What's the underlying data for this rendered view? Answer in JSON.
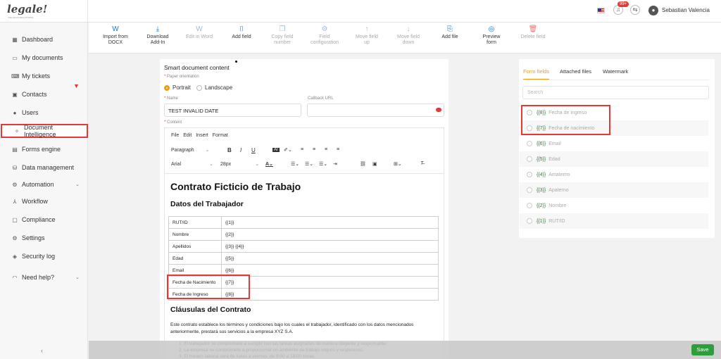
{
  "brand": {
    "logo_text": "legale!",
    "logo_sub": "THE LEGALTECH PORTAL"
  },
  "topbar": {
    "notif_badge": "99+",
    "username": "Sebastian Valencia"
  },
  "sidebar": {
    "items": [
      {
        "label": "Dashboard",
        "icon": "dashboard-icon",
        "glyph": "▦"
      },
      {
        "label": "My documents",
        "icon": "folder-icon",
        "glyph": "▭"
      },
      {
        "label": "My tickets",
        "icon": "ticket-icon",
        "glyph": "⌨"
      },
      {
        "label": "Contacts",
        "icon": "contacts-icon",
        "glyph": "▣"
      },
      {
        "label": "Users",
        "icon": "user-icon",
        "glyph": "●"
      },
      {
        "label": "Document Intelligence",
        "icon": "sparkle-icon",
        "glyph": "✧"
      },
      {
        "label": "Forms engine",
        "icon": "form-icon",
        "glyph": "▤"
      },
      {
        "label": "Data management",
        "icon": "database-icon",
        "glyph": "⛁"
      },
      {
        "label": "Automation",
        "icon": "automation-icon",
        "glyph": "⚙"
      },
      {
        "label": "Workflow",
        "icon": "workflow-icon",
        "glyph": "⅄"
      },
      {
        "label": "Compliance",
        "icon": "compliance-icon",
        "glyph": "▢"
      },
      {
        "label": "Settings",
        "icon": "settings-icon",
        "glyph": "⚙"
      },
      {
        "label": "Security log",
        "icon": "shield-icon",
        "glyph": "◈"
      },
      {
        "label": "Need help?",
        "icon": "headset-icon",
        "glyph": "◠"
      }
    ],
    "collapse_label": "‹"
  },
  "toolbar": {
    "buttons": [
      {
        "label_1": "Import from",
        "label_2": "DOCX",
        "icon": "word-icon",
        "glyph": "W"
      },
      {
        "label_1": "Download",
        "label_2": "Add-In",
        "icon": "download-icon",
        "glyph": "⤓"
      },
      {
        "label_1": "Edit in Word",
        "label_2": "",
        "icon": "word-icon",
        "glyph": "W"
      },
      {
        "label_1": "Add field",
        "label_2": "",
        "icon": "add-field-icon",
        "glyph": "⌷"
      },
      {
        "label_1": "Copy field",
        "label_2": "number",
        "icon": "copy-icon",
        "glyph": "❐"
      },
      {
        "label_1": "Field",
        "label_2": "configuration",
        "icon": "gear-icon",
        "glyph": "⚙"
      },
      {
        "label_1": "Move field",
        "label_2": "up",
        "icon": "arrow-up-icon",
        "glyph": "↑"
      },
      {
        "label_1": "Move field",
        "label_2": "down",
        "icon": "arrow-down-icon",
        "glyph": "↓"
      },
      {
        "label_1": "Add file",
        "label_2": "",
        "icon": "add-file-icon",
        "glyph": "⎘"
      },
      {
        "label_1": "Preview",
        "label_2": "form",
        "icon": "eye-icon",
        "glyph": "◎"
      },
      {
        "label_1": "Delete field",
        "label_2": "",
        "icon": "trash-icon",
        "glyph": "🗑"
      }
    ]
  },
  "form": {
    "title": "Smart document content",
    "orientation_label": "Paper orientation",
    "orientation_options": [
      "Portrait",
      "Landscape"
    ],
    "name_label": "Name",
    "name_value": "TEST INVALID DATE",
    "callback_label": "Callback URL",
    "callback_value": "",
    "content_label": "Content"
  },
  "editor": {
    "menus": "File Edit Insert Format",
    "block_format": "Paragraph",
    "font_family": "Arial",
    "font_size": "28px"
  },
  "document": {
    "h1": "Contrato Ficticio de Trabajo",
    "h2_worker": "Datos del Trabajador",
    "rows": [
      [
        "RUT/ID",
        "{{1}}"
      ],
      [
        "Nombre",
        "{{2}}"
      ],
      [
        "Apellidos",
        "{{3}} {{4}}"
      ],
      [
        "Edad",
        "{{5}}"
      ],
      [
        "Email",
        "{{6}}"
      ],
      [
        "Fecha de Nacimiento",
        "{{7}}"
      ],
      [
        "Fecha de Ingreso",
        "{{8}}"
      ]
    ],
    "h2_clauses": "Cláusulas del Contrato",
    "paragraph": "Este contrato establece los términos y condiciones bajo los cuales el trabajador, identificado con los datos mencionados anteriormente, prestará sus servicios a la empresa XYZ S.A.",
    "clauses": [
      "1. El trabajador se compromete a cumplir con las tareas asignadas de manera diligente y responsable.",
      "2. La empresa se compromete a proporcionar un ambiente de trabajo seguro y respetuoso.",
      "3. El horario laboral será de lunes a viernes, de 9:00 a 18:00 horas."
    ]
  },
  "panel": {
    "tabs": [
      "Form fields",
      "Attached files",
      "Watermark"
    ],
    "search_placeholder": "Search",
    "fields": [
      {
        "code": "{{8}}",
        "name": "Fecha de ingreso"
      },
      {
        "code": "{{7}}",
        "name": "Fecha de nacimiento"
      },
      {
        "code": "{{6}}",
        "name": "Email"
      },
      {
        "code": "{{5}}",
        "name": "Edad"
      },
      {
        "code": "{{4}}",
        "name": "Amaterno"
      },
      {
        "code": "{{3}}",
        "name": "Apaterno"
      },
      {
        "code": "{{2}}",
        "name": "Nombre"
      },
      {
        "code": "{{1}}",
        "name": "RUT/ID"
      }
    ]
  },
  "footer": {
    "save_label": "Save"
  },
  "colors": {
    "accent": "#f39c12",
    "highlight": "#e53935",
    "save": "#2e9d3c",
    "field_code": "#2e7d32"
  }
}
